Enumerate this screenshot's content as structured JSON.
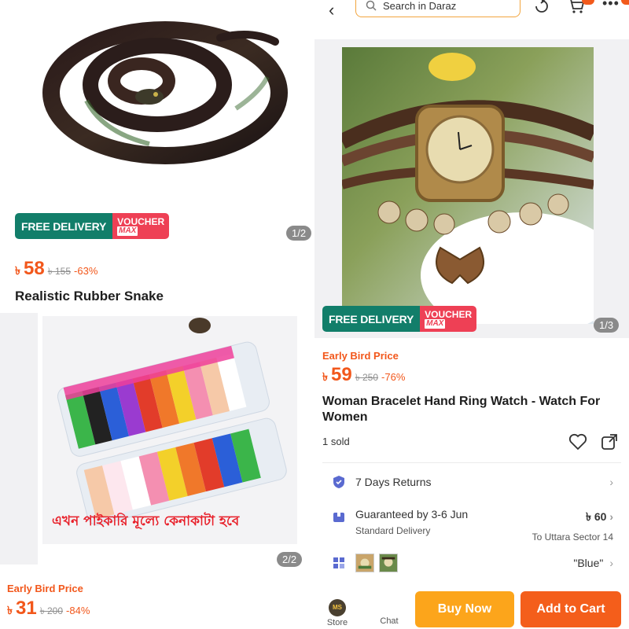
{
  "left": {
    "snake": {
      "badge_free": "FREE DELIVERY",
      "badge_voucher": "VOUCHER",
      "badge_max": "MAX",
      "counter": "1/2",
      "currency": "৳",
      "price": "58",
      "old_price": "৳ 155",
      "discount": "-63%",
      "title": "Realistic Rubber Snake"
    },
    "clay": {
      "banner_text": "এখন পাইকারি মূল্যে কেনাকাটা হবে",
      "counter": "2/2",
      "early_bird": "Early Bird Price",
      "currency": "৳",
      "price": "31",
      "old_price": "৳ 200",
      "discount": "-84%"
    }
  },
  "right": {
    "topbar": {
      "back_icon": "back-arrow-icon",
      "search_placeholder": "Search in Daraz"
    },
    "product": {
      "badge_free": "FREE DELIVERY",
      "badge_voucher": "VOUCHER",
      "badge_max": "MAX",
      "counter": "1/3",
      "early_bird": "Early Bird Price",
      "currency": "৳",
      "price": "59",
      "old_price": "৳ 250",
      "discount": "-76%",
      "title": "Woman Bracelet Hand Ring Watch - Watch For Women",
      "sold": "1 sold"
    },
    "returns": {
      "label": "7 Days Returns"
    },
    "delivery": {
      "label": "Guaranteed by 3-6 Jun",
      "price": "৳ 60",
      "type": "Standard Delivery",
      "location": "To Uttara Sector 14"
    },
    "variant": {
      "selected": "\"Blue\""
    },
    "bottom": {
      "store_label": "Store",
      "store_logo": "MS",
      "chat_label": "Chat",
      "buy_now": "Buy Now",
      "add_to_cart": "Add to Cart"
    }
  },
  "colors": {
    "accent_orange": "#f2571b",
    "free_delivery_green": "#127e6a",
    "voucher_red": "#ee4055",
    "buy_now": "#fca51b",
    "add_to_cart": "#f45e1b"
  }
}
